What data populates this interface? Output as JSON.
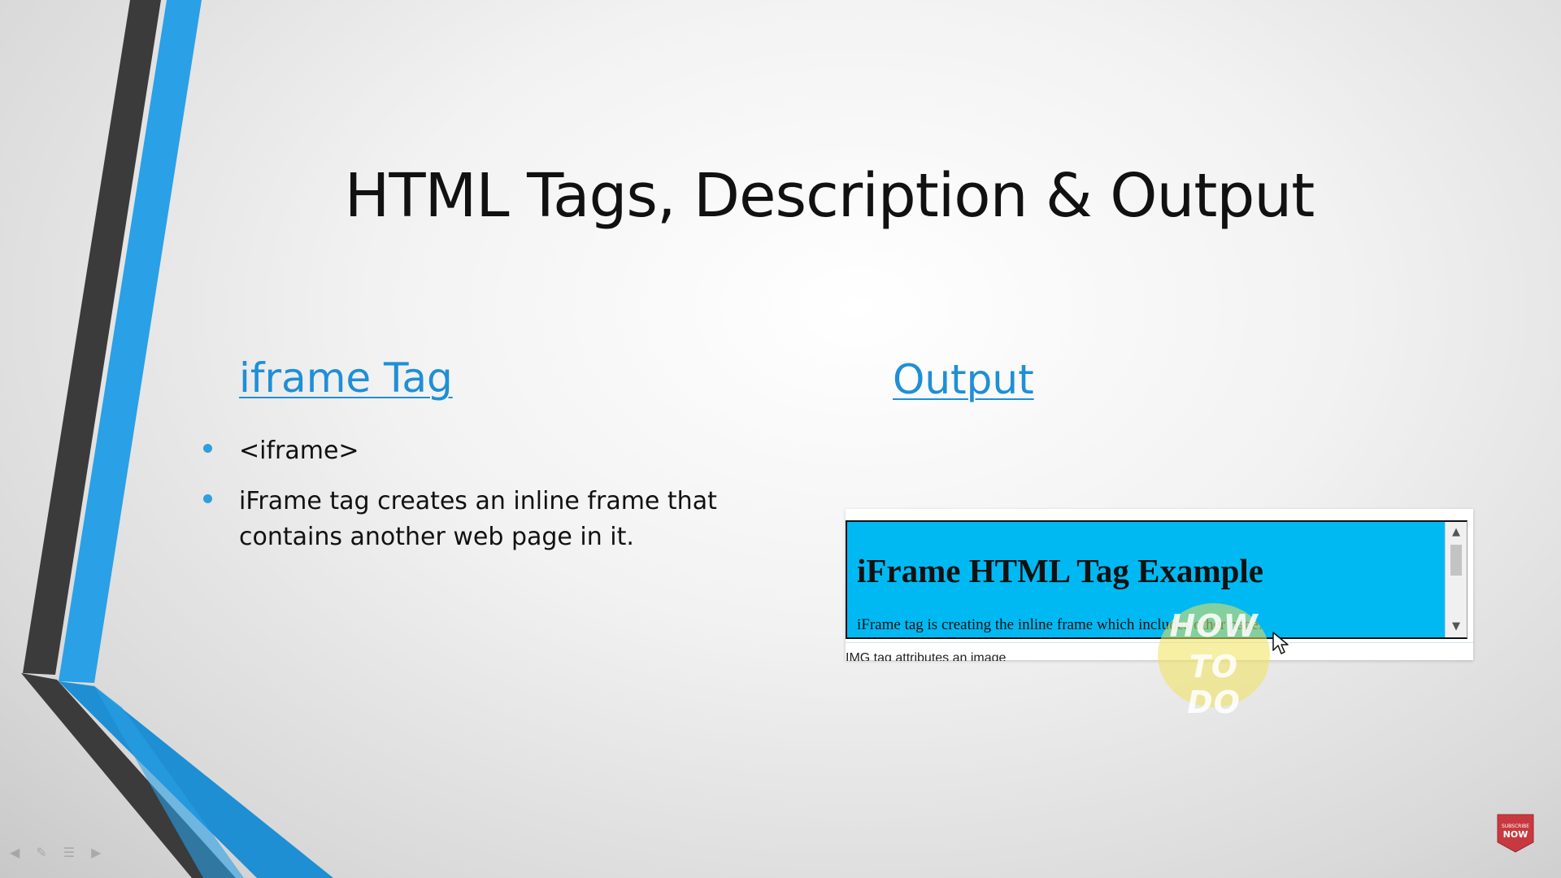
{
  "slide": {
    "title": "HTML Tags, Description & Output",
    "left_heading": "iframe Tag",
    "right_heading": "Output",
    "bullets": [
      {
        "text": "<iframe>"
      },
      {
        "text": "iFrame tag creates an inline frame that contains another web page in it."
      }
    ]
  },
  "output_example": {
    "iframe_heading": "iFrame HTML Tag Example",
    "iframe_text": "iFrame tag is creating the inline frame which includes other page.",
    "below_text": "IMG tag attributes an image",
    "iframe_background": "#00b9f2"
  },
  "watermark": {
    "line1": "HOW",
    "line2": "TO DO"
  },
  "subscribe_badge": {
    "small_text": "SUBSCRIBE",
    "big_text": "NOW",
    "color": "#c8393f"
  },
  "icons": {
    "scroll_up": "chevron-up-icon",
    "scroll_down": "chevron-down-icon",
    "cursor": "mouse-pointer-icon",
    "nav_prev": "arrow-left-icon",
    "nav_pen": "pen-icon",
    "nav_menu": "menu-icon",
    "nav_next": "arrow-right-icon"
  },
  "colors": {
    "accent_blue": "#2e9fdf",
    "heading_blue": "#1f8fd6",
    "dark_stripe": "#3a3a3a"
  }
}
